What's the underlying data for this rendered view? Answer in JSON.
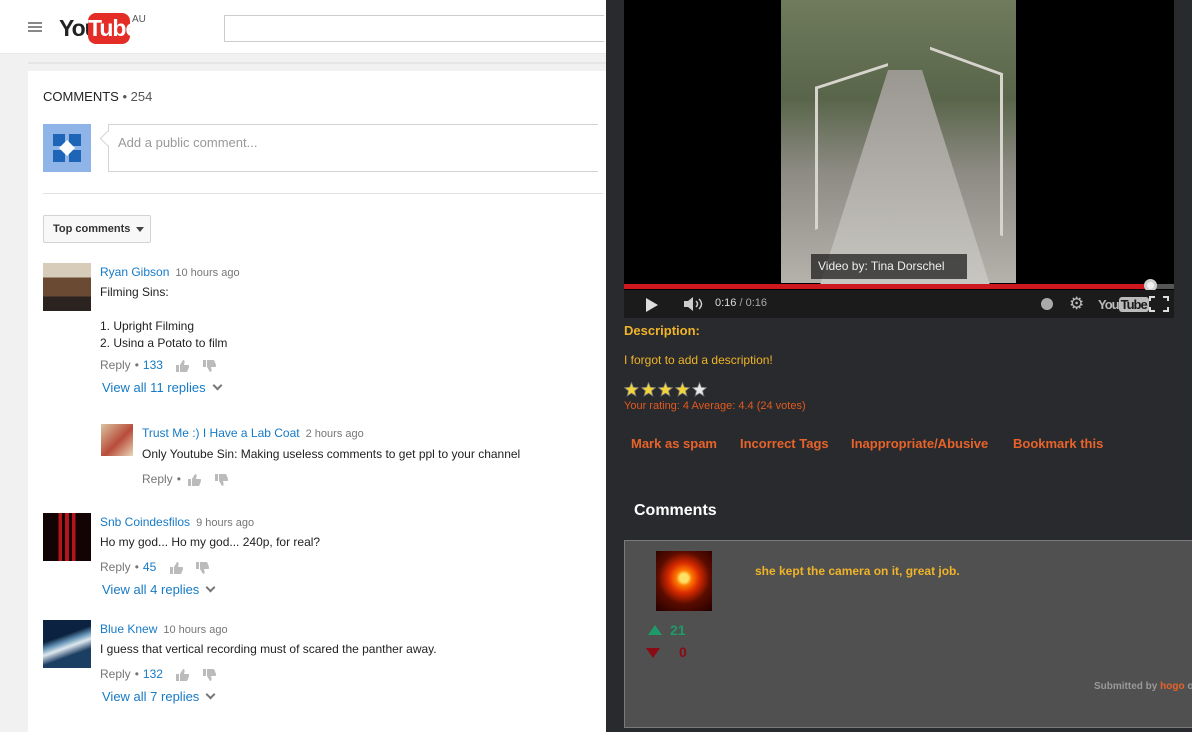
{
  "youtube": {
    "logo_you": "You",
    "logo_tube": "Tube",
    "logo_region": "AU",
    "comments_label": "COMMENTS",
    "comments_count": "• 254",
    "comment_placeholder": "Add a public comment...",
    "sort_label": "Top comments",
    "reply_label": "Reply",
    "separator": "•",
    "comments": [
      {
        "author": "Ryan Gibson",
        "time": "10 hours ago",
        "lines": [
          "Filming Sins:",
          "",
          "1. Upright Filming",
          "2. Using a Potato to film"
        ],
        "likes": "133",
        "replies_link": "View all 11 replies"
      },
      {
        "author": "Trust Me :) I Have a Lab Coat",
        "time": "2 hours ago",
        "lines": [
          "Only Youtube Sin: Making useless comments to get ppl to your channel"
        ]
      },
      {
        "author": "Snb Coindesfilos",
        "time": "9 hours ago",
        "lines": [
          "Ho my god... Ho my god... 240p, for real?"
        ],
        "likes": "45",
        "replies_link": "View all 4 replies"
      },
      {
        "author": "Blue Knew",
        "time": "10 hours ago",
        "lines": [
          "I guess that vertical recording must of scared the panther away."
        ],
        "likes": "132",
        "replies_link": "View all 7 replies"
      }
    ]
  },
  "player": {
    "credit": "Video by: Tina Dorschel",
    "current_time": "0:16",
    "time_sep": " / ",
    "duration": "0:16",
    "progress_fraction": 0.956,
    "yt_mark_you": "You",
    "yt_mark_tube": "Tube"
  },
  "site": {
    "description_label": "Description:",
    "description_text": "I forgot to add a description!",
    "rating_stars": 5,
    "rating_text": "Your rating: 4 Average: 4.4 (24 votes)",
    "actions": [
      "Mark as spam",
      "Incorrect Tags",
      "Inappropriate/Abusive",
      "Bookmark this"
    ],
    "comments_title": "Comments",
    "comment": {
      "text": "she kept the camera on it,  great job.",
      "up_votes": "21",
      "down_votes": "0",
      "submitted_prefix": "Submitted by",
      "submitted_user": "hogo",
      "submitted_suffix": "o"
    }
  },
  "colors": {
    "yt_red": "#e52d27",
    "yt_link": "#167ac6",
    "site_yellow": "#f0b429",
    "site_orange": "#e8632a",
    "progress_red": "#cc181e",
    "vote_up": "#1e9a6a",
    "vote_down": "#8b0b14"
  }
}
